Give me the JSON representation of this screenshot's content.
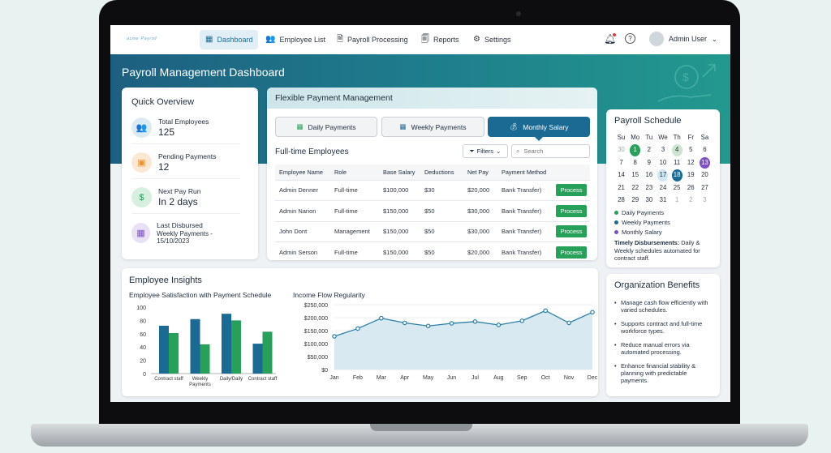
{
  "nav": {
    "logo": "ᵃᶜᵐᵉ ᴾᵃʸʳᵒˡˡ",
    "items": [
      {
        "label": "Dashboard",
        "icon": "dashboard-icon"
      },
      {
        "label": "Employee List",
        "icon": "users-icon"
      },
      {
        "label": "Payroll Processing",
        "icon": "document-icon"
      },
      {
        "label": "Reports",
        "icon": "report-icon"
      },
      {
        "label": "Settings",
        "icon": "gear-icon"
      }
    ],
    "user": "Admin User"
  },
  "page_title": "Payroll Management Dashboard",
  "overview": {
    "title": "Quick Overview",
    "items": [
      {
        "label": "Total Employees",
        "value": "125",
        "color": "#2a7fa8"
      },
      {
        "label": "Pending Payments",
        "value": "12",
        "color": "#e8923a"
      },
      {
        "label": "Next Pay Run",
        "value": "In 2 days",
        "color": "#27a05a"
      },
      {
        "label": "Last Disbursed",
        "value": "Weekly Payments - 15/10/2023",
        "color": "#7c4fc4"
      }
    ]
  },
  "payments": {
    "title": "Flexible Payment Management",
    "tabs": [
      "Daily Payments",
      "Weekly Payments",
      "Monthly Salary"
    ],
    "active_tab": 2,
    "subtitle": "Full-time Employees",
    "filters_label": "Filters",
    "search_placeholder": "Search",
    "columns": [
      "Employee Name",
      "Role",
      "Base Salary",
      "Deductions",
      "Net Pay",
      "Payment Method",
      ""
    ],
    "rows": [
      {
        "name": "Admin Denner",
        "role": "Full-time",
        "base": "$100,000",
        "ded": "$30",
        "net": "$20,000",
        "method": "Bank Transfer)",
        "action": "Process"
      },
      {
        "name": "Admin Narion",
        "role": "Full-time",
        "base": "$150,000",
        "ded": "$50",
        "net": "$30,000",
        "method": "Bank Transfer)",
        "action": "Process"
      },
      {
        "name": "John Dont",
        "role": "Management",
        "base": "$150,000",
        "ded": "$50",
        "net": "$30,000",
        "method": "Bank Transfer)",
        "action": "Process"
      },
      {
        "name": "Admin Serson",
        "role": "Full-time",
        "base": "$150,000",
        "ded": "$50",
        "net": "$20,000",
        "method": "Bank Transfer)",
        "action": "Process"
      }
    ]
  },
  "schedule": {
    "title": "Payroll Schedule",
    "weekdays": [
      "Su",
      "Mo",
      "Tu",
      "We",
      "Th",
      "Fr",
      "Sa"
    ],
    "days": [
      "30",
      "1",
      "2",
      "3",
      "4",
      "5",
      "6",
      "7",
      "8",
      "9",
      "10",
      "11",
      "12",
      "13",
      "14",
      "15",
      "16",
      "17",
      "18",
      "19",
      "20",
      "21",
      "22",
      "23",
      "24",
      "25",
      "26",
      "27",
      "28",
      "29",
      "30",
      "31",
      "1",
      "2",
      "3"
    ],
    "highlights": {
      "1": "#27a05a",
      "4": "#cde5d0",
      "17": "#cfe6f3",
      "18": "#1a6a93",
      "13": "#7c4fc4"
    },
    "legend": [
      {
        "label": "Daily Payments",
        "color": "#27a05a"
      },
      {
        "label": "Weekly Payments",
        "color": "#1a6a93"
      },
      {
        "label": "Monthly Salary",
        "color": "#7c4fc4"
      }
    ],
    "note_bold": "Timely Disbursements:",
    "note_text": " Daily & Weekly schedules automated for contract staff."
  },
  "insights": {
    "title": "Employee Insights",
    "bar_title": "Employee Satisfaction with Payment Schedule",
    "line_title": "Income Flow Regularity"
  },
  "benefits": {
    "title": "Organization Benefits",
    "items": [
      "Manage cash flow efficiently with varied schedules.",
      "Supports contract and full-time workforce types.",
      "Reduce manual errors via automated processing.",
      "Enhance financial stability & planning with predictable payments."
    ]
  },
  "chart_data": [
    {
      "type": "bar",
      "title": "Employee Satisfaction with Payment Schedule",
      "categories": [
        "Contract staff",
        "Weekly Payments",
        "Daily/Daily",
        "Contract staff"
      ],
      "series": [
        {
          "values": [
            72,
            82,
            90,
            45
          ],
          "color": "#1a6a93"
        },
        {
          "values": [
            61,
            44,
            80,
            63
          ],
          "color": "#27a05a"
        }
      ],
      "ylim": [
        0,
        100
      ],
      "yticks": [
        0,
        20,
        40,
        60,
        80,
        100
      ]
    },
    {
      "type": "area",
      "title": "Income Flow Regularity",
      "categories": [
        "Jan",
        "Feb",
        "Mar",
        "Apr",
        "May",
        "Jun",
        "Jul",
        "Aug",
        "Sep",
        "Oct",
        "Nov",
        "Dec"
      ],
      "values": [
        128000,
        158000,
        198000,
        180000,
        168000,
        178000,
        185000,
        172000,
        188000,
        227000,
        180000,
        221000
      ],
      "ylim": [
        0,
        250000
      ],
      "yticks": [
        "$0",
        "$50,000",
        "$100,000",
        "$150,000",
        "$200,000",
        "$250,000"
      ],
      "color": "#2a7fa8"
    }
  ]
}
